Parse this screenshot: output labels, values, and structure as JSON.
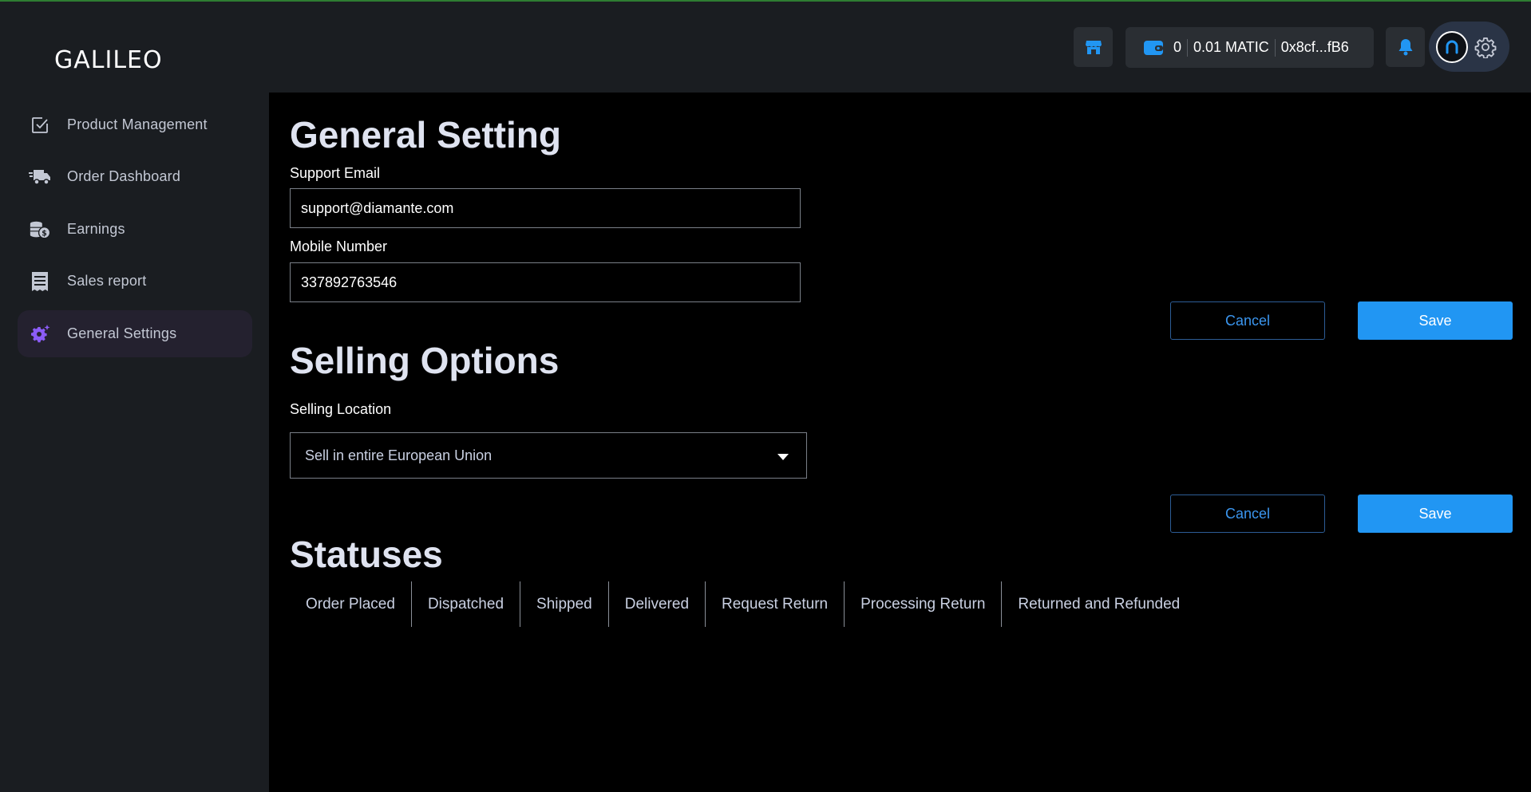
{
  "app": {
    "logo": "GALILEO"
  },
  "header": {
    "wallet": {
      "balance": "0",
      "matic": "0.01 MATIC",
      "address": "0x8cf...fB6"
    }
  },
  "sidebar": {
    "items": [
      {
        "label": "Product Management",
        "icon": "checkbox-icon"
      },
      {
        "label": "Order Dashboard",
        "icon": "truck-icon"
      },
      {
        "label": "Earnings",
        "icon": "coins-icon"
      },
      {
        "label": "Sales report",
        "icon": "receipt-icon"
      },
      {
        "label": "General Settings",
        "icon": "gear-icon",
        "active": true
      }
    ]
  },
  "general": {
    "title": "General Setting",
    "email_label": "Support Email",
    "email_value": "support@diamante.com",
    "mobile_label": "Mobile Number",
    "mobile_value": "337892763546",
    "cancel": "Cancel",
    "save": "Save"
  },
  "selling": {
    "title": "Selling Options",
    "location_label": "Selling Location",
    "location_value": "Sell in entire European Union",
    "cancel": "Cancel",
    "save": "Save"
  },
  "statuses": {
    "title": "Statuses",
    "items": [
      "Order Placed",
      "Dispatched",
      "Shipped",
      "Delivered",
      "Request Return",
      "Processing Return",
      "Returned and Refunded"
    ]
  },
  "colors": {
    "accent": "#2196f3",
    "active_icon": "#8b5cf6",
    "background": "#1a1d21",
    "main": "#000000"
  }
}
